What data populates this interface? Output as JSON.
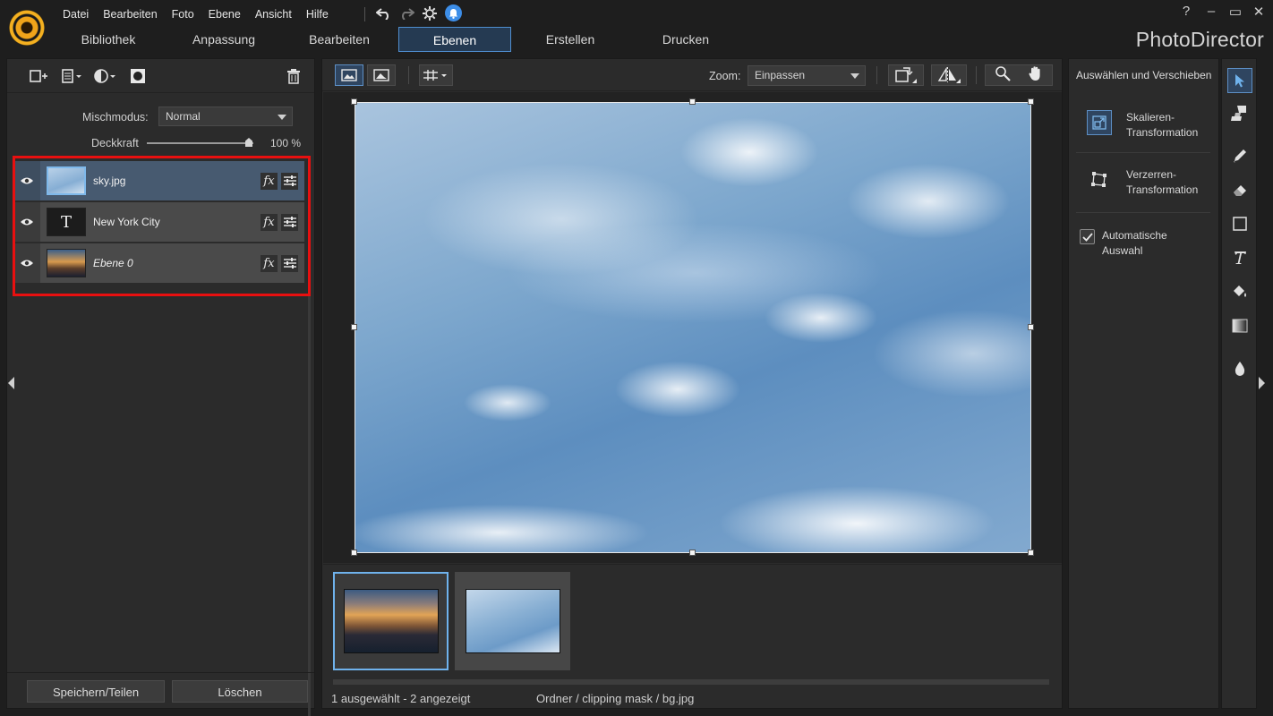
{
  "menu": [
    "Datei",
    "Bearbeiten",
    "Foto",
    "Ebene",
    "Ansicht",
    "Hilfe"
  ],
  "window_controls": [
    "?",
    "–",
    "▭",
    "✕"
  ],
  "main_tabs": [
    "Bibliothek",
    "Anpassung",
    "Bearbeiten",
    "Ebenen",
    "Erstellen",
    "Drucken"
  ],
  "active_tab": "Ebenen",
  "brand": "PhotoDirector",
  "layers_panel": {
    "blend_mode_label": "Mischmodus:",
    "blend_mode_value": "Normal",
    "opacity_label": "Deckkraft",
    "opacity_value": "100 %",
    "opacity_fraction": 1.0,
    "layers": [
      {
        "name": "sky.jpg",
        "type": "image",
        "selected": true
      },
      {
        "name": "New York City",
        "type": "text",
        "selected": false
      },
      {
        "name": "Ebene 0",
        "type": "image",
        "selected": false
      }
    ],
    "text_layer_glyph": "T",
    "fx_label": "fx",
    "save_share_label": "Speichern/Teilen",
    "delete_label": "Löschen"
  },
  "center": {
    "zoom_label": "Zoom:",
    "zoom_value": "Einpassen",
    "status_selection": "1 ausgewählt - 2 angezeigt",
    "status_path": "Ordner / clipping mask / bg.jpg"
  },
  "right_panel": {
    "title": "Auswählen und Verschieben",
    "scale_transform": [
      "Skalieren-",
      "Transformation"
    ],
    "distort_transform": [
      "Verzerren-",
      "Transformation"
    ],
    "auto_select": [
      "Automatische",
      "Auswahl"
    ],
    "auto_select_checked": true
  },
  "tools": [
    "select-arrow",
    "brush-stamp",
    "pencil",
    "eraser",
    "rectangle",
    "text",
    "paint-bucket",
    "gradient",
    "water-drop"
  ],
  "colors": {
    "accent_blue": "#4f8ed0",
    "highlight_red": "#e81010",
    "panel_bg": "#2b2b2b",
    "app_bg": "#1e1e1e"
  }
}
